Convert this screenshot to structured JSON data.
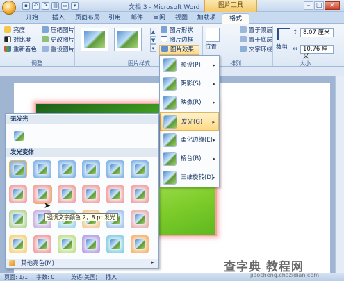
{
  "title_bar": {
    "doc_title": "文档 3 - Microsoft Word",
    "picture_tools": "图片工具",
    "btn_min": "–",
    "btn_max": "□",
    "btn_close": "×"
  },
  "tabs": [
    "开始",
    "插入",
    "页面布局",
    "引用",
    "邮件",
    "审阅",
    "视图",
    "加载项",
    "格式"
  ],
  "ribbon": {
    "adjust": {
      "label": "调整",
      "items": [
        "亮度",
        "对比度",
        "重新着色",
        "压缩图片",
        "更改图片",
        "重设图片"
      ]
    },
    "picture_styles": {
      "label": "图片样式",
      "items": [
        "图片形状",
        "图片边框",
        "图片效果"
      ]
    },
    "arrange": {
      "label": "排列",
      "position": "位置",
      "items": [
        "置于顶层",
        "置于底层",
        "文字环绕"
      ]
    },
    "size": {
      "label": "大小",
      "crop": "裁剪",
      "height": "8.07 厘米",
      "width": "10.76 厘米"
    }
  },
  "effects_menu": {
    "items": [
      {
        "label": "预设(P)"
      },
      {
        "label": "阴影(S)"
      },
      {
        "label": "映像(R)"
      },
      {
        "label": "发光(G)"
      },
      {
        "label": "柔化边缘(E)"
      },
      {
        "label": "棱台(B)"
      },
      {
        "label": "三维旋转(D)"
      }
    ],
    "hovered_index": 3
  },
  "glow_panel": {
    "no_glow_header": "无发光",
    "variations_header": "发光变体",
    "more_colors": "其他亮色(M)",
    "tooltip": "强调文字颜色 2，8 pt 发光",
    "selected": [
      0,
      0
    ],
    "hovered": [
      1,
      1
    ],
    "rows": [
      [
        "#7fb2e5",
        "#7fb2e5",
        "#7fb2e5",
        "#7fb2e5",
        "#7fb2e5",
        "#7fb2e5"
      ],
      [
        "#f0a0a0",
        "#f0a0a0",
        "#f0a0a0",
        "#f0a0a0",
        "#f0a0a0",
        "#f0a0a0"
      ],
      [
        "#b6d39a",
        "#c7b2e0",
        "#9fd6e8",
        "#f6c98e",
        "#a3c4ec",
        "#e8b0b0"
      ],
      [
        "#f6d37b",
        "#f39c9c",
        "#c3e08b",
        "#b59ee6",
        "#86cfe3",
        "#f7b36e"
      ]
    ]
  },
  "status_bar": {
    "page": "页面: 1/1",
    "words": "字数: 0",
    "lang": "英语(美国)",
    "mode": "插入"
  },
  "watermark": {
    "main": "查字典 教程网",
    "sub": "jiaocheng.chazidian.com"
  }
}
